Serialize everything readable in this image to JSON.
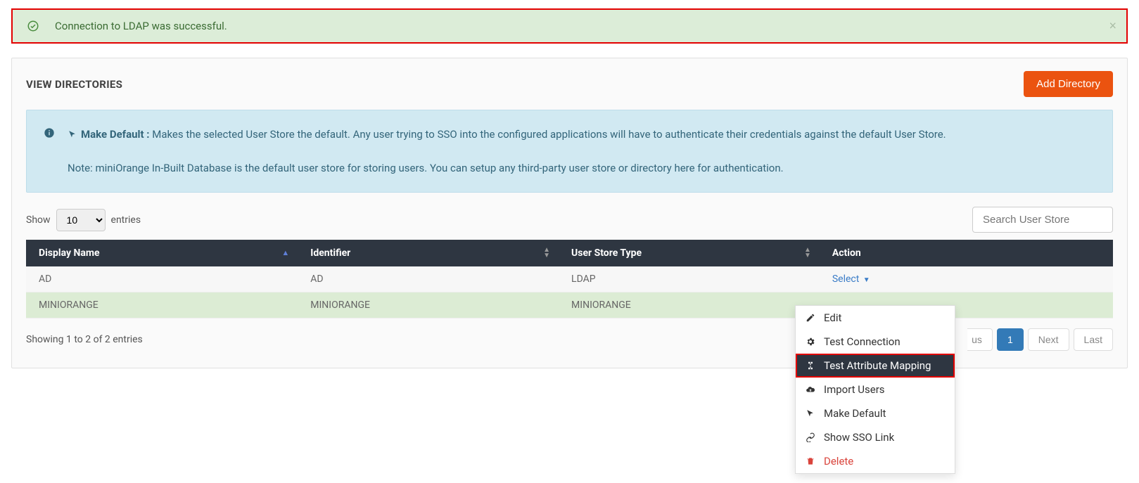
{
  "alert": {
    "message": "Connection to LDAP was successful."
  },
  "card": {
    "title": "VIEW DIRECTORIES",
    "addBtn": "Add Directory"
  },
  "info": {
    "prefix_bold": "Make Default :",
    "text": " Makes the selected User Store the default. Any user trying to SSO into the configured applications will have to authenticate their credentials against the default User Store.",
    "note": "Note: miniOrange In-Built Database is the default user store for storing users. You can setup any third-party user store or directory here for authentication."
  },
  "tableControls": {
    "show": "Show",
    "entriesVal": "10",
    "entries": "entries",
    "searchPlaceholder": "Search User Store"
  },
  "columns": {
    "c0": "Display Name",
    "c1": "Identifier",
    "c2": "User Store Type",
    "c3": "Action"
  },
  "rows": [
    {
      "display": "AD",
      "identifier": "AD",
      "type": "LDAP",
      "action": "Select"
    },
    {
      "display": "MINIORANGE",
      "identifier": "MINIORANGE",
      "type": "MINIORANGE",
      "action": ""
    }
  ],
  "footer": {
    "info": "Showing 1 to 2 of 2 entries",
    "pages": {
      "prevPartial": "us",
      "p1": "1",
      "next": "Next",
      "last": "Last"
    }
  },
  "dropdown": {
    "edit": "Edit",
    "test": "Test Connection",
    "attr": "Test Attribute Mapping",
    "import": "Import Users",
    "default": "Make Default",
    "sso": "Show SSO Link",
    "delete": "Delete"
  }
}
